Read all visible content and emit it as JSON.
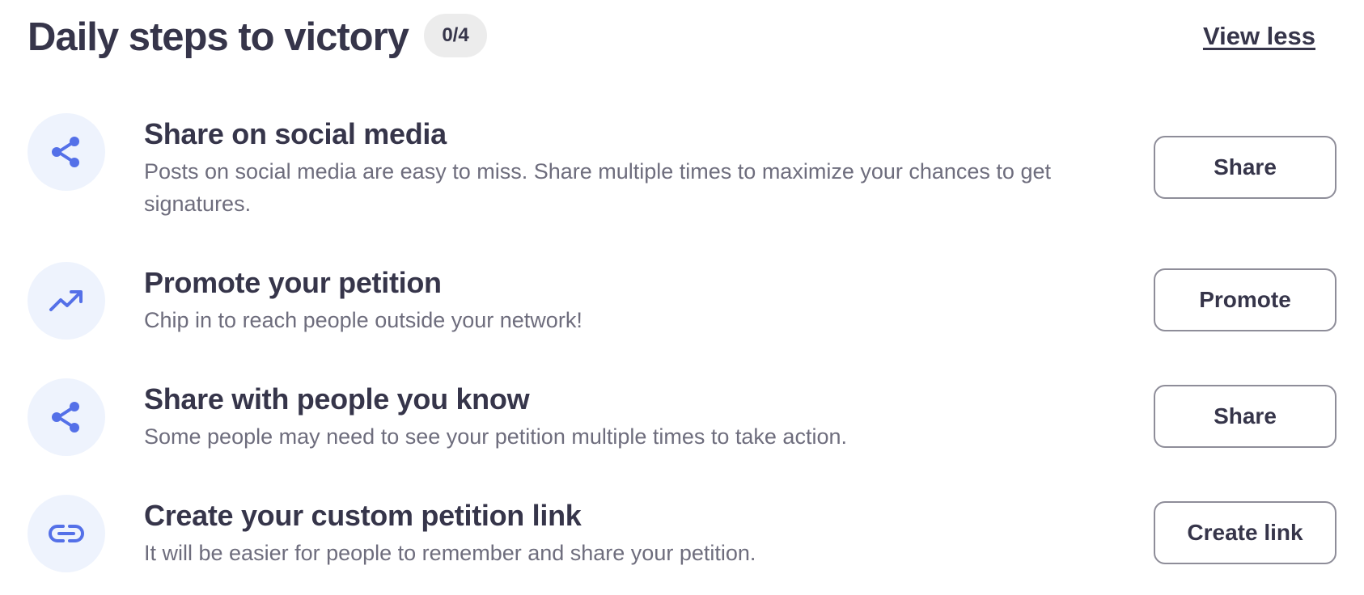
{
  "header": {
    "title": "Daily steps to victory",
    "progress": "0/4",
    "view_less_label": "View less"
  },
  "accent_color": "#5470e8",
  "icon_bg_color": "#eef3fd",
  "steps": [
    {
      "icon": "share-icon",
      "title": "Share on social media",
      "description": "Posts on social media are easy to miss. Share multiple times to maximize your chances to get signatures.",
      "button_label": "Share"
    },
    {
      "icon": "trending-up-icon",
      "title": "Promote your petition",
      "description": "Chip in to reach people outside your network!",
      "button_label": "Promote"
    },
    {
      "icon": "share-icon",
      "title": "Share with people you know",
      "description": "Some people may need to see your petition multiple times to take action.",
      "button_label": "Share"
    },
    {
      "icon": "link-icon",
      "title": "Create your custom petition link",
      "description": "It will be easier for people to remember and share your petition.",
      "button_label": "Create link"
    }
  ]
}
